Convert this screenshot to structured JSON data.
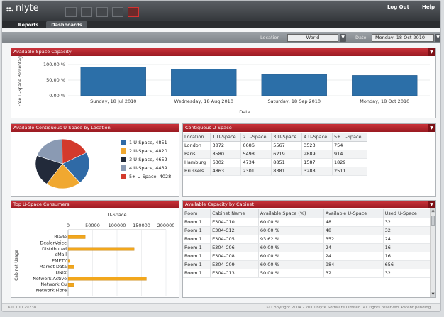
{
  "app": {
    "logo_text": "nlyte"
  },
  "header": {
    "links": [
      "Log Out",
      "Help"
    ],
    "tabs": [
      "Reports",
      "Dashboards"
    ],
    "tool_icons": [
      "grid-icon",
      "table-icon",
      "import-icon",
      "tree-icon",
      "bar-chart-icon"
    ]
  },
  "filters": {
    "location_label": "Location",
    "location_value": "World",
    "date_label": "Date",
    "date_value": "Monday, 18 Oct 2010"
  },
  "colors": {
    "accent": "#b1232a",
    "bar": "#2c6fa8",
    "orange": "#f2a71c"
  },
  "panels": {
    "space_capacity": {
      "title": "Available Space Capacity"
    },
    "contiguous_pie": {
      "title": "Available Contiguous U-Space by Location"
    },
    "contiguous_table": {
      "title": "Contiguous U-Space",
      "columns": [
        "Location",
        "1 U-Space",
        "2 U-Space",
        "3 U-Space",
        "4 U-Space",
        "5+ U-Space"
      ],
      "rows": [
        [
          "London",
          "3872",
          "6686",
          "5567",
          "3523",
          "754"
        ],
        [
          "Paris",
          "8580",
          "5498",
          "6219",
          "2889",
          "914"
        ],
        [
          "Hamburg",
          "6302",
          "4734",
          "8851",
          "1587",
          "1829"
        ],
        [
          "Brussels",
          "4863",
          "2301",
          "8381",
          "3288",
          "2511"
        ]
      ]
    },
    "top_consumers": {
      "title": "Top U-Space Consumers"
    },
    "capacity_by_cabinet": {
      "title": "Available Capacity by Cabinet",
      "columns": [
        "Room",
        "Cabinet Name",
        "Available Space (%)",
        "Available U-Space",
        "Used U-Space"
      ],
      "rows": [
        [
          "Room 1",
          "E304-C10",
          "60.00 %",
          "48",
          "32"
        ],
        [
          "Room 1",
          "E304-C12",
          "60.00 %",
          "48",
          "32"
        ],
        [
          "Room 1",
          "E304-C05",
          "93.62 %",
          "352",
          "24"
        ],
        [
          "Room 1",
          "E304-C06",
          "60.00 %",
          "24",
          "16"
        ],
        [
          "Room 1",
          "E304-C08",
          "60.00 %",
          "24",
          "16"
        ],
        [
          "Room 1",
          "E304-C09",
          "60.00 %",
          "984",
          "656"
        ],
        [
          "Room 1",
          "E304-C13",
          "50.00 %",
          "32",
          "32"
        ]
      ]
    }
  },
  "status": {
    "version": "6.0.100.29238",
    "copyright": "© Copyright 2004 - 2010 nlyte Software Limited. All rights reserved. Patent pending."
  },
  "chart_data": [
    {
      "type": "bar",
      "title": "Available Space Capacity",
      "categories": [
        "Sunday, 18 Jul 2010",
        "Wednesday, 18 Aug 2010",
        "Saturday, 18 Sep 2010",
        "Monday, 18 Oct 2010"
      ],
      "values": [
        92,
        85,
        68,
        65
      ],
      "xlabel": "Date",
      "ylabel": "Free U-Space Percentage",
      "yticks": [
        "0.00 %",
        "50.00 %",
        "100.00 %"
      ],
      "ylim": [
        0,
        100
      ],
      "grid": true
    },
    {
      "type": "pie",
      "title": "Available Contiguous U-Space by Location",
      "labels": [
        "1 U-Space, 4851",
        "2 U-Space, 4820",
        "3 U-Space, 4652",
        "4 U-Space, 4439",
        "5+ U-Space, 4028"
      ],
      "values": [
        4851,
        4820,
        4652,
        4439,
        4028
      ],
      "colors": [
        "#2f6aa6",
        "#f0a830",
        "#222a3a",
        "#8a9ab3",
        "#d33a2c"
      ],
      "legend_position": "right"
    },
    {
      "type": "bar",
      "orientation": "horizontal",
      "title": "Top U-Space Consumers",
      "xlabel": "U-Space",
      "ylabel": "Cabinet Usage",
      "categories": [
        "Blade",
        "DealerVoice",
        "Distributed",
        "eMail",
        "EMPTY",
        "Market Data",
        "UNIX",
        "Network Active",
        "Network Cu",
        "Network Fibre"
      ],
      "values": [
        35000,
        0,
        135000,
        0,
        3000,
        12000,
        0,
        160000,
        12000,
        0
      ],
      "xticks": [
        "0",
        "50000",
        "100000",
        "150000",
        "200000"
      ],
      "xlim": [
        0,
        200000
      ]
    }
  ]
}
